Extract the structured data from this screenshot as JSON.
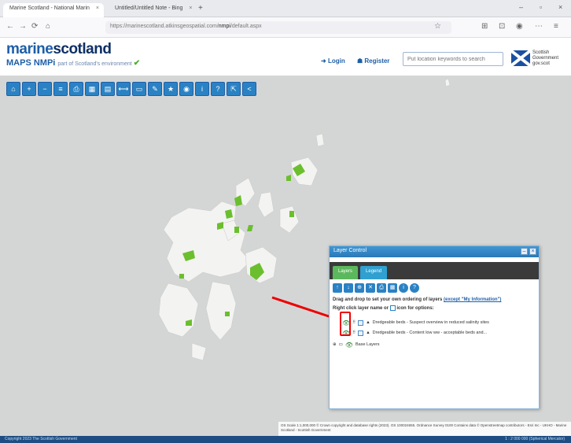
{
  "browser": {
    "tabs": [
      {
        "title": "Marine Scotland - National Marin",
        "close": "×"
      },
      {
        "title": "Untitled/Untitled Note - Bing",
        "close": "×"
      }
    ],
    "new_tab": "+",
    "window_controls": {
      "minimize": "–",
      "restore": "▫",
      "close": "×"
    },
    "nav": {
      "back": "←",
      "forward": "→",
      "reload": "⟳",
      "home": "⌂"
    },
    "url_prefix": "https://marinescotland.atkinsgeospatial.com/",
    "url_highlight": "nmpi",
    "url_suffix": "/default.aspx",
    "address_icons": [
      "☆",
      "⊞",
      "⊡",
      "◉",
      "⋯",
      "≡"
    ]
  },
  "header": {
    "logo_part1": "marine",
    "logo_part2": "scotland",
    "logo_line2": "MAPS NMPi",
    "logo_sub": "part of Scotland's environment",
    "login_label": "Login",
    "register_label": "Register",
    "search_placeholder": "Put location keywords to search",
    "gov_line1": "Scottish",
    "gov_line2": "Government",
    "gov_line3": "gov.scot"
  },
  "toolbar": {
    "icons": [
      "home-icon",
      "zoom-in-icon",
      "zoom-out-icon",
      "layers-icon",
      "print-icon",
      "table-icon",
      "grid-icon",
      "measure-icon",
      "select-icon",
      "draw-icon",
      "bookmark-icon",
      "identify-icon",
      "info-icon",
      "help-icon",
      "share-icon",
      "collapse-icon"
    ],
    "glyphs": [
      "⌂",
      "+",
      "−",
      "≡",
      "⎙",
      "▦",
      "▤",
      "⟷",
      "▭",
      "✎",
      "★",
      "◉",
      "i",
      "?",
      "⇱",
      "<"
    ]
  },
  "layer_panel": {
    "title": "Layer Control",
    "tabs": [
      "Layers",
      "Legend"
    ],
    "tool_glyphs": [
      "↑",
      "↓",
      "⊕",
      "✕",
      "⎙",
      "▦",
      "i",
      "?"
    ],
    "info_line1": "Drag and drop to set your own ordering of layers",
    "info_link": "(except \"My Information\")",
    "info_line2_pre": "Right click layer name or",
    "info_line2_post": "icon for options:",
    "layers": [
      {
        "label": "Dredgeable beds - Suspect overview in reduced salinity sites"
      },
      {
        "label": "Dredgeable beds - Content low ww - acceptable beds and..."
      }
    ],
    "base_layer_label": "Base Layers"
  },
  "attribution": "OS Scale 1:1,000,000 © Crown copyright and database rights (2023). OS 100024655. Ordnance Survey 0100 Contains data © Openstreetmap contributors - Esri Inc - UKHO - Marine Scotland - Scottish Government",
  "status": {
    "left": "Copyright 2023 The Scottish Government",
    "right": "1 : 2 000 000 (Spherical Mercator)"
  },
  "colors": {
    "brand_blue": "#1d5fa8",
    "tool_blue": "#2a82c4",
    "sea": "#d4d6d6",
    "land": "#f3f3f1",
    "feature_green": "#6bbf2e",
    "highlight_red": "#e00000"
  }
}
